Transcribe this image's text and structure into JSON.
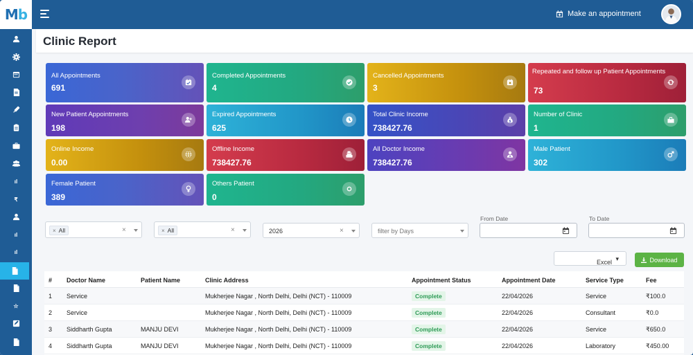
{
  "app": {
    "logo": "Mb",
    "make_appointment": "Make an appointment"
  },
  "page": {
    "title": "Clinic Report"
  },
  "sidebar": {
    "items": [
      {
        "icon": "user-icon"
      },
      {
        "icon": "gear-icon"
      },
      {
        "icon": "calendar-icon"
      },
      {
        "icon": "file-icon"
      },
      {
        "icon": "syringe-icon"
      },
      {
        "icon": "clipboard-icon"
      },
      {
        "icon": "briefcase-icon"
      },
      {
        "icon": "users-icon"
      },
      {
        "icon": "bar-chart-icon",
        "text": "ıl"
      },
      {
        "icon": "rupee-icon",
        "text": "₹"
      },
      {
        "icon": "user-icon"
      },
      {
        "icon": "bar-chart-icon",
        "text": "ıl"
      },
      {
        "icon": "bar-chart-icon",
        "text": "ıl"
      },
      {
        "icon": "document-icon"
      },
      {
        "icon": "document-icon"
      },
      {
        "icon": "star-icon",
        "text": "☆"
      },
      {
        "icon": "edit-icon"
      },
      {
        "icon": "document-icon"
      }
    ],
    "active_index": 13
  },
  "cards": [
    {
      "label": "All Appointments",
      "value": "691",
      "icon": "calendar-check-icon",
      "style": "g-blue"
    },
    {
      "label": "Completed Appointments",
      "value": "4",
      "icon": "check-circle-icon",
      "style": "g-green"
    },
    {
      "label": "Cancelled Appointments",
      "value": "3",
      "icon": "calendar-x-icon",
      "style": "g-gold"
    },
    {
      "label": "Repeated and follow up Patient Appointments",
      "value": "73",
      "icon": "sync-icon",
      "style": "g-red"
    },
    {
      "label": "New Patient Appointments",
      "value": "198",
      "icon": "user-plus-icon",
      "style": "g-purple"
    },
    {
      "label": "Expired Appointments",
      "value": "625",
      "icon": "clock-icon",
      "style": "g-cyan"
    },
    {
      "label": "Total Clinic Income",
      "value": "738427.76",
      "icon": "money-bag-icon",
      "style": "g-indigo"
    },
    {
      "label": "Number of Clinic",
      "value": "1",
      "icon": "clinic-icon",
      "style": "g-green"
    },
    {
      "label": "Online Income",
      "value": "0.00",
      "icon": "globe-icon",
      "style": "g-gold"
    },
    {
      "label": "Offline Income",
      "value": "738427.76",
      "icon": "cash-register-icon",
      "style": "g-red"
    },
    {
      "label": "All Doctor Income",
      "value": "738427.76",
      "icon": "doctor-icon",
      "style": "g-purple2"
    },
    {
      "label": "Male Patient",
      "value": "302",
      "icon": "male-icon",
      "style": "g-cyan"
    },
    {
      "label": "Female Patient",
      "value": "389",
      "icon": "female-icon",
      "style": "g-blue"
    },
    {
      "label": "Others Patient",
      "value": "0",
      "icon": "circle-icon",
      "style": "g-green"
    }
  ],
  "filters": {
    "doctor": {
      "chip": "All"
    },
    "clinic": {
      "chip": "All"
    },
    "year": {
      "value": "2026"
    },
    "days": {
      "placeholder": "filter by Days"
    },
    "from_date": {
      "label": "From Date"
    },
    "to_date": {
      "label": "To Date"
    }
  },
  "export": {
    "format": "Excel",
    "download_label": "Download"
  },
  "table": {
    "headers": [
      "#",
      "Doctor Name",
      "Patient Name",
      "Clinic Address",
      "Appointment Status",
      "Appointment Date",
      "Service Type",
      "Fee"
    ],
    "rows": [
      {
        "num": "1",
        "doctor": "Service",
        "patient": "",
        "address": "Mukherjee Nagar , North Delhi, Delhi (NCT) - 110009",
        "status": "Complete",
        "date": "22/04/2026",
        "service": "Service",
        "fee": "₹100.0"
      },
      {
        "num": "2",
        "doctor": "Service",
        "patient": "",
        "address": "Mukherjee Nagar , North Delhi, Delhi (NCT) - 110009",
        "status": "Complete",
        "date": "22/04/2026",
        "service": "Consultant",
        "fee": "₹0.0"
      },
      {
        "num": "3",
        "doctor": "Siddharth Gupta",
        "patient": "MANJU DEVI",
        "address": "Mukherjee Nagar , North Delhi, Delhi (NCT) - 110009",
        "status": "Complete",
        "date": "22/04/2026",
        "service": "Service",
        "fee": "₹650.0"
      },
      {
        "num": "4",
        "doctor": "Siddharth Gupta",
        "patient": "MANJU DEVI",
        "address": "Mukherjee Nagar , North Delhi, Delhi (NCT) - 110009",
        "status": "Complete",
        "date": "22/04/2026",
        "service": "Laboratory",
        "fee": "₹450.00"
      }
    ]
  }
}
